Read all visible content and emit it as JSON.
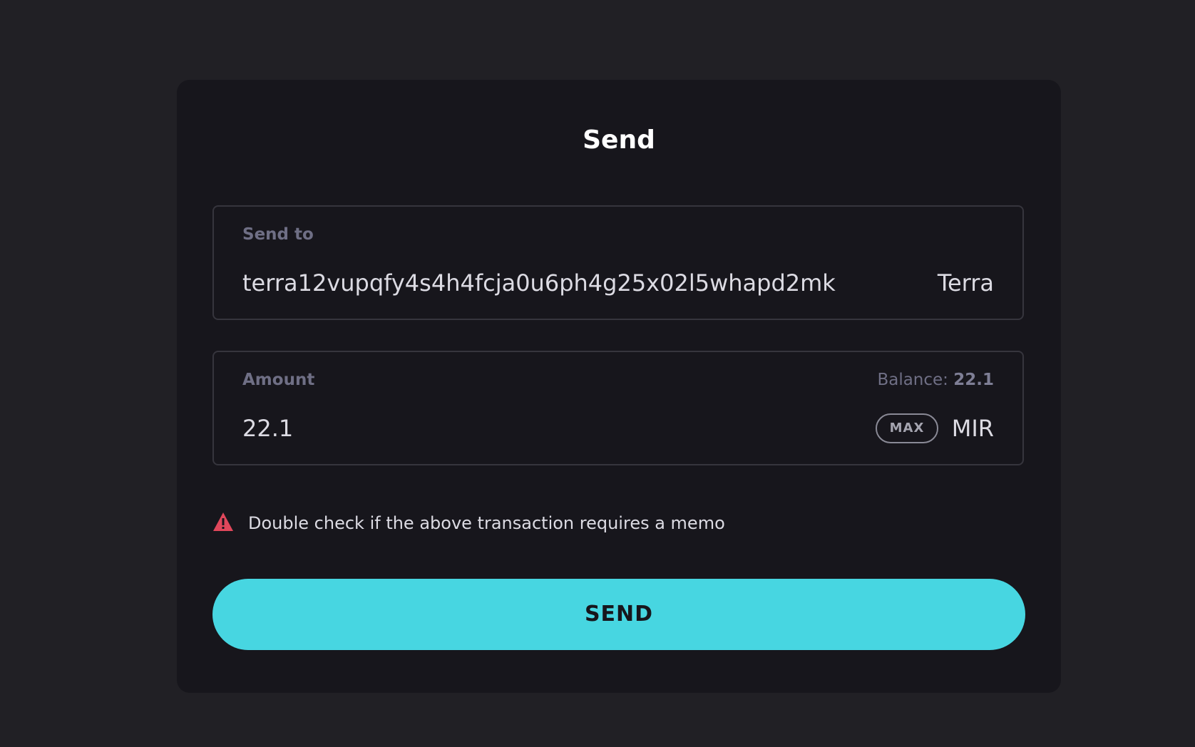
{
  "title": "Send",
  "send_to": {
    "label": "Send to",
    "value": "terra12vupqfy4s4h4fcja0u6ph4g25x02l5whapd2mk",
    "network": "Terra"
  },
  "amount": {
    "label": "Amount",
    "balance_label": "Balance:",
    "balance_value": "22.1",
    "value": "22.1",
    "max_label": "MAX",
    "token": "MIR"
  },
  "warning": {
    "icon": "warning-triangle-icon",
    "text": "Double check if the above transaction requires a memo",
    "color": "#e0475b"
  },
  "send_button": {
    "label": "SEND",
    "color": "#47d6e1"
  }
}
